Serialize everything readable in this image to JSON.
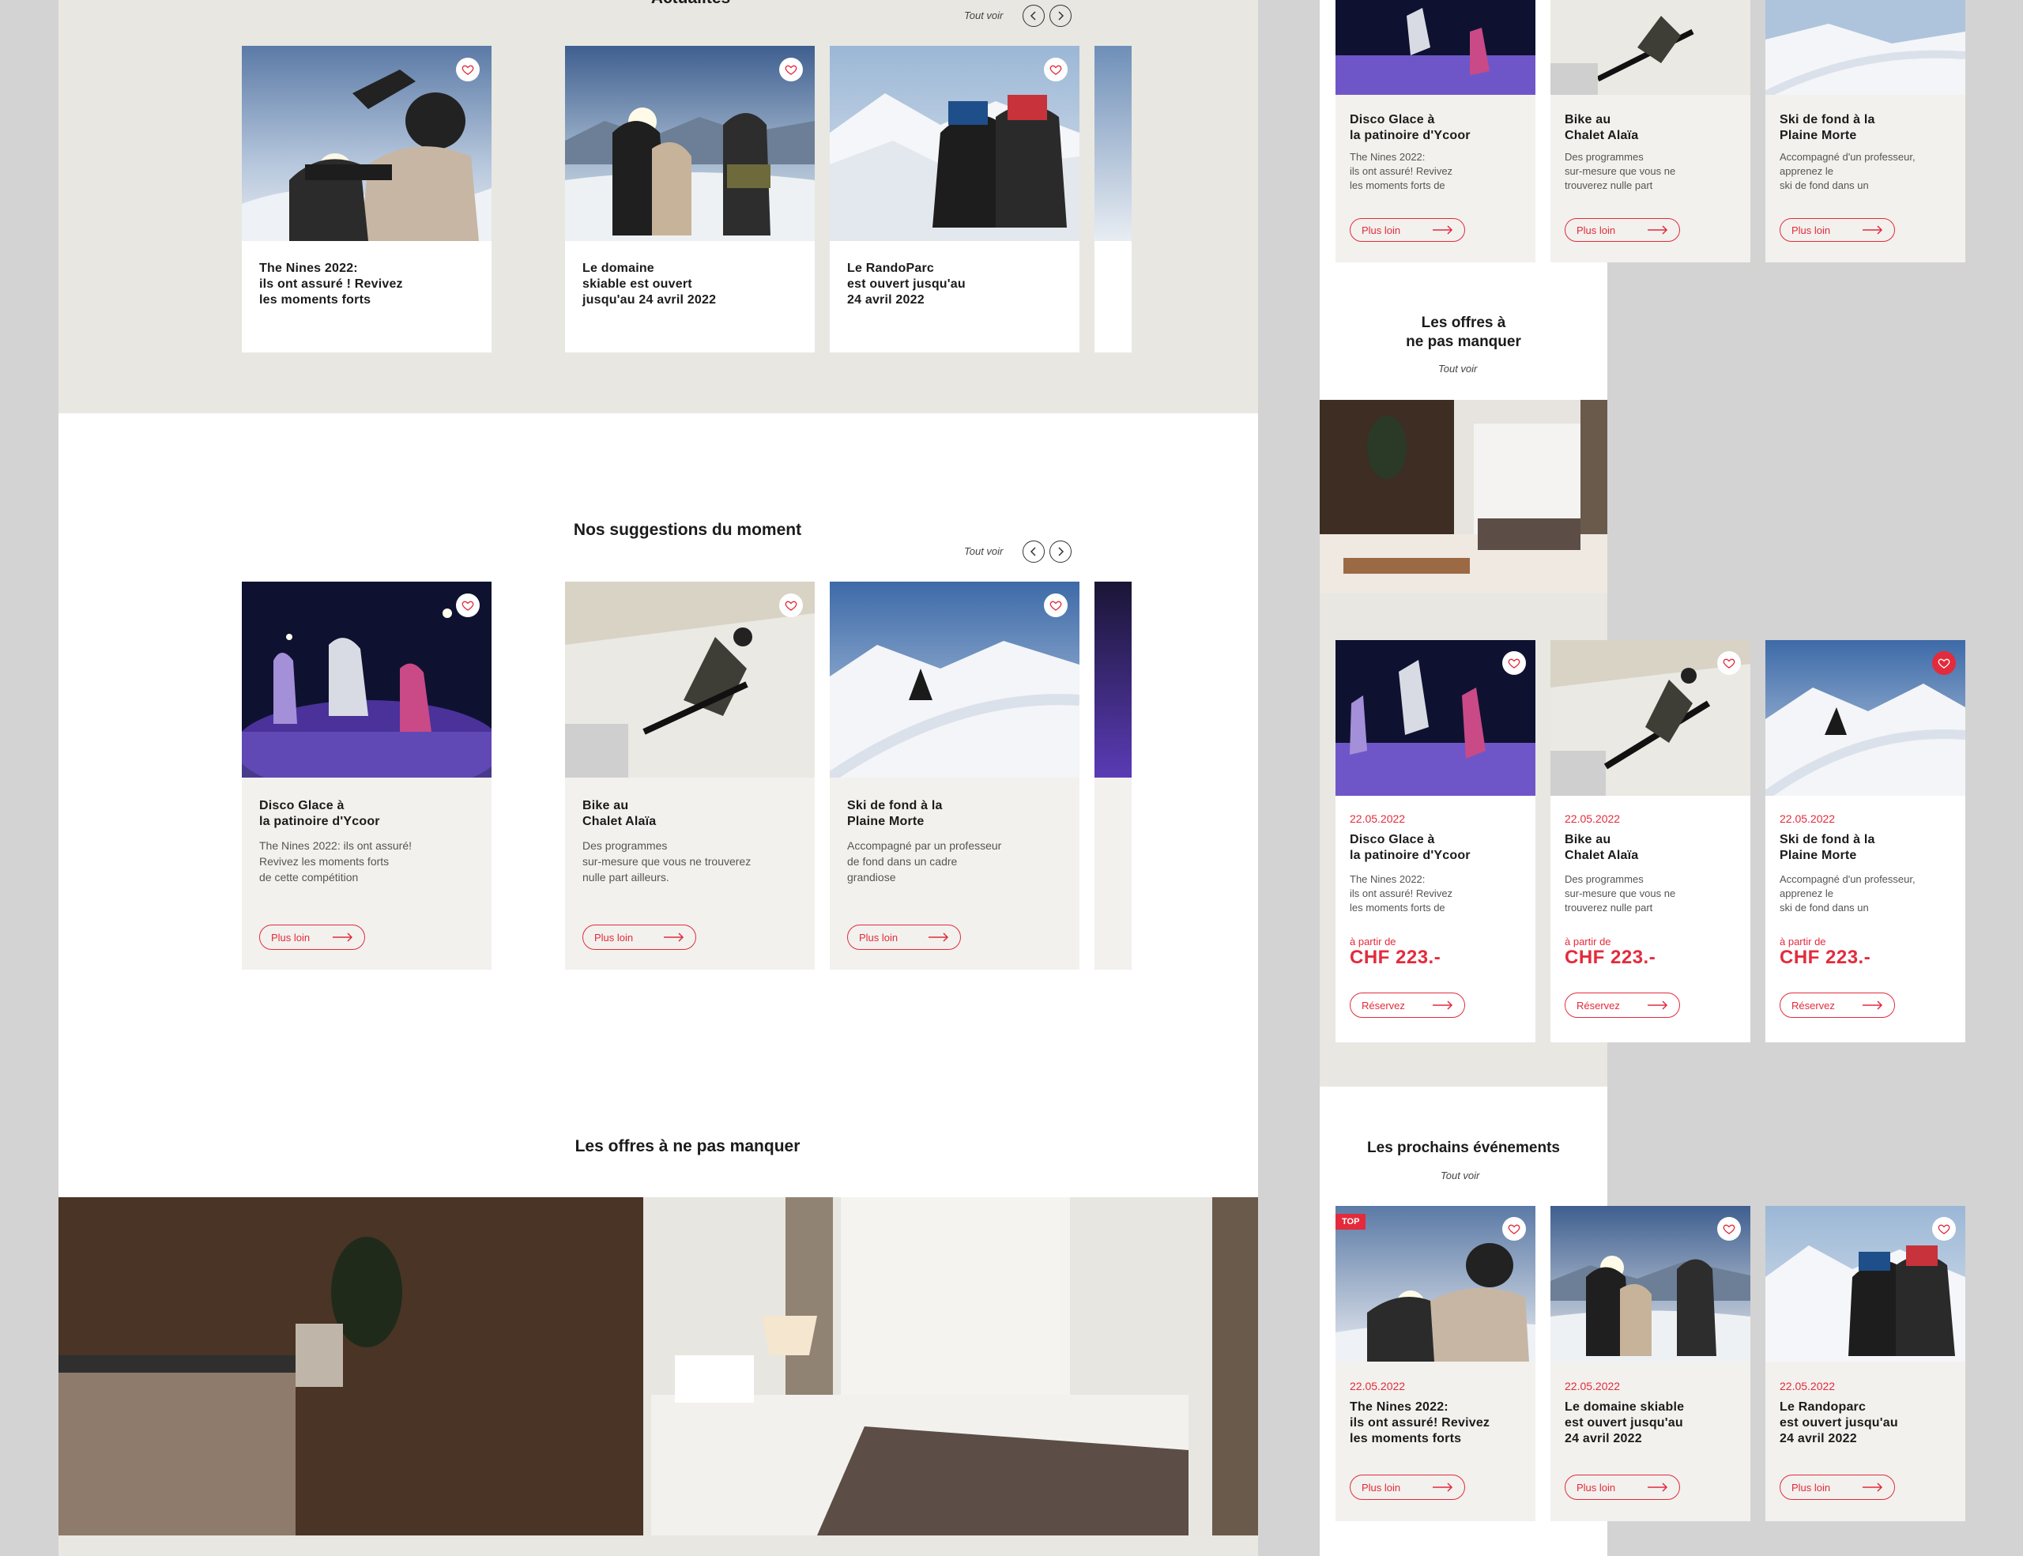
{
  "colors": {
    "accent": "#e32b3c",
    "beige": "#e8e7e2",
    "card": "#f2f1ee"
  },
  "actualites": {
    "title_partial": "Actualités",
    "see_all": "Tout voir",
    "cards": [
      {
        "title": "The Nines 2022:\nils ont assuré ! Revivez\nles moments forts"
      },
      {
        "title": "Le domaine\nskiable est ouvert\njusqu'au 24 avril 2022"
      },
      {
        "title": "Le RandoParc\nest ouvert jusqu'au\n24 avril 2022"
      }
    ]
  },
  "suggestions": {
    "title": "Nos suggestions du moment",
    "see_all": "Tout voir",
    "cards": [
      {
        "title": "Disco Glace à\nla patinoire d'Ycoor",
        "desc": "The Nines 2022: ils ont assuré!\nRevivez les moments forts\nde cette compétition",
        "cta": "Plus loin"
      },
      {
        "title": "Bike au\nChalet Alaïa",
        "desc": "Des programmes\nsur-mesure que vous ne trouverez\nnulle part ailleurs.",
        "cta": "Plus loin"
      },
      {
        "title": "Ski de fond à la\nPlaine Morte",
        "desc": "Accompagné par un professeur\nde fond dans un cadre\ngrandiose",
        "cta": "Plus loin"
      }
    ]
  },
  "offres": {
    "title": "Les offres à ne pas manquer"
  },
  "mobile": {
    "top_cards": [
      {
        "title": "Disco Glace à\nla patinoire d'Ycoor",
        "desc": "The Nines 2022:\nils ont assuré! Revivez\nles moments forts de",
        "cta": "Plus loin"
      },
      {
        "title": "Bike au\nChalet Alaïa",
        "desc": "Des programmes\nsur-mesure que vous ne\ntrouverez nulle part",
        "cta": "Plus loin"
      },
      {
        "title": "Ski de fond à la\nPlaine Morte",
        "desc": "Accompagné d'un professeur,\napprenez le\nski de fond dans un",
        "cta": "Plus loin"
      }
    ],
    "offres_title": "Les offres à\nne pas manquer",
    "offres_see_all": "Tout voir",
    "offer_cards": [
      {
        "date": "22.05.2022",
        "title": "Disco Glace à\nla patinoire d'Ycoor",
        "desc": "The Nines 2022:\nils ont assuré! Revivez\nles moments forts de",
        "from": "à partir de",
        "price": "CHF 223.-",
        "cta": "Réservez",
        "fav": false
      },
      {
        "date": "22.05.2022",
        "title": "Bike au\nChalet Alaïa",
        "desc": "Des programmes\nsur-mesure que vous ne\ntrouverez nulle part",
        "from": "à partir de",
        "price": "CHF 223.-",
        "cta": "Réservez",
        "fav": false
      },
      {
        "date": "22.05.2022",
        "title": "Ski de fond à la\nPlaine Morte",
        "desc": "Accompagné d'un professeur,\napprenez le\nski de fond dans un",
        "from": "à partir de",
        "price": "CHF 223.-",
        "cta": "Réservez",
        "fav": true
      }
    ],
    "events_title": "Les prochains événements",
    "events_see_all": "Tout voir",
    "event_cards": [
      {
        "badge": "TOP",
        "date": "22.05.2022",
        "title": "The Nines 2022:\nils ont assuré! Revivez\nles moments forts",
        "cta": "Plus loin"
      },
      {
        "date": "22.05.2022",
        "title": "Le domaine skiable\nest ouvert jusqu'au\n24 avril 2022",
        "cta": "Plus loin"
      },
      {
        "date": "22.05.2022",
        "title": "Le Randoparc\nest ouvert jusqu'au\n24 avril 2022",
        "cta": "Plus loin"
      }
    ]
  }
}
